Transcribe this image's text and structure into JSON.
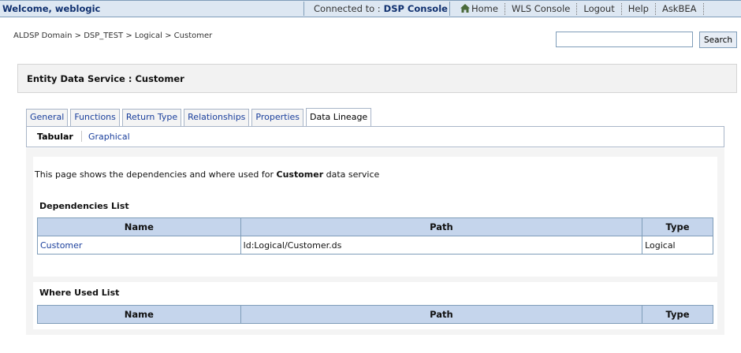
{
  "header": {
    "welcome": "Welcome, weblogic",
    "connected_label": "Connected to :",
    "connected_value": "DSP Console",
    "nav": [
      "Home",
      "WLS Console",
      "Logout",
      "Help",
      "AskBEA"
    ]
  },
  "breadcrumb": "ALDSP Domain > DSP_TEST > Logical > Customer",
  "search": {
    "value": "",
    "button_label": "Search"
  },
  "page_title": "Entity Data Service : Customer",
  "tabs": [
    "General",
    "Functions",
    "Return Type",
    "Relationships",
    "Properties",
    "Data Lineage"
  ],
  "active_tab": "Data Lineage",
  "subtabs": {
    "active": "Tabular",
    "other": "Graphical"
  },
  "description": {
    "prefix": "This page shows the dependencies and where used for",
    "service": "Customer",
    "suffix": "data service"
  },
  "dependencies": {
    "title": "Dependencies List",
    "columns": [
      "Name",
      "Path",
      "Type"
    ],
    "rows": [
      {
        "name": "Customer",
        "path": "ld:Logical/Customer.ds",
        "type": "Logical"
      }
    ]
  },
  "where_used": {
    "title": "Where Used List",
    "columns": [
      "Name",
      "Path",
      "Type"
    ],
    "rows": []
  }
}
